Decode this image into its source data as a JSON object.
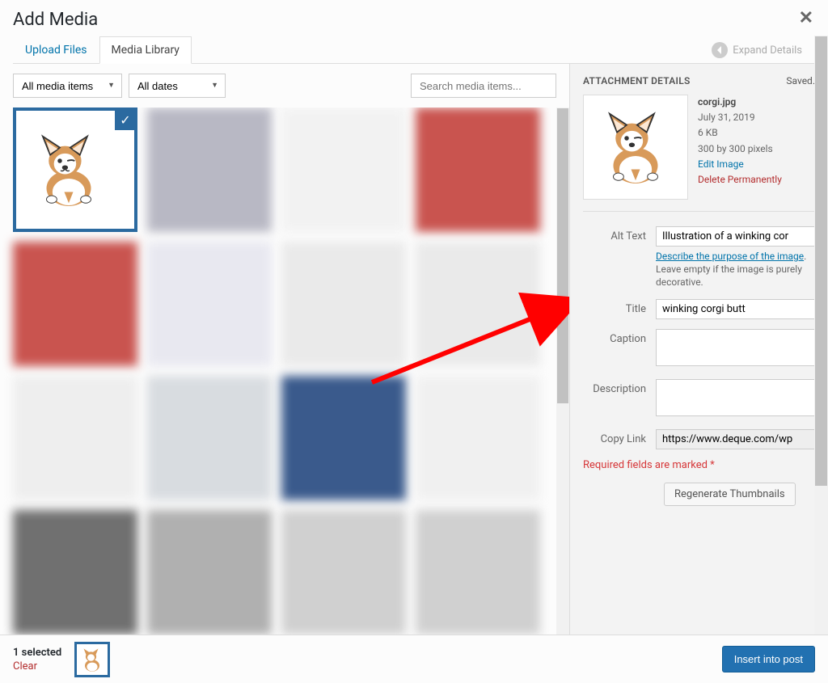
{
  "header": {
    "title": "Add Media",
    "expand": "Expand Details"
  },
  "tabs": {
    "upload": "Upload Files",
    "library": "Media Library"
  },
  "filters": {
    "media_type": "All media items",
    "dates": "All dates",
    "search_placeholder": "Search media items..."
  },
  "details": {
    "heading": "ATTACHMENT DETAILS",
    "saved": "Saved.",
    "filename": "corgi.jpg",
    "date": "July 31, 2019",
    "size": "6 KB",
    "dimensions": "300 by 300 pixels",
    "edit_link": "Edit Image",
    "delete_link": "Delete Permanently"
  },
  "fields": {
    "alt_label": "Alt Text",
    "alt_value": "Illustration of a winking cor",
    "alt_hint_link": "Describe the purpose of the image",
    "alt_hint_rest": ". Leave empty if the image is purely decorative.",
    "title_label": "Title",
    "title_value": "winking corgi butt",
    "caption_label": "Caption",
    "caption_value": "",
    "desc_label": "Description",
    "desc_value": "",
    "link_label": "Copy Link",
    "link_value": "https://www.deque.com/wp",
    "required": "Required fields are marked ",
    "required_star": "*",
    "regen": "Regenerate Thumbnails"
  },
  "footer": {
    "count": "1 selected",
    "clear": "Clear",
    "insert": "Insert into post"
  }
}
